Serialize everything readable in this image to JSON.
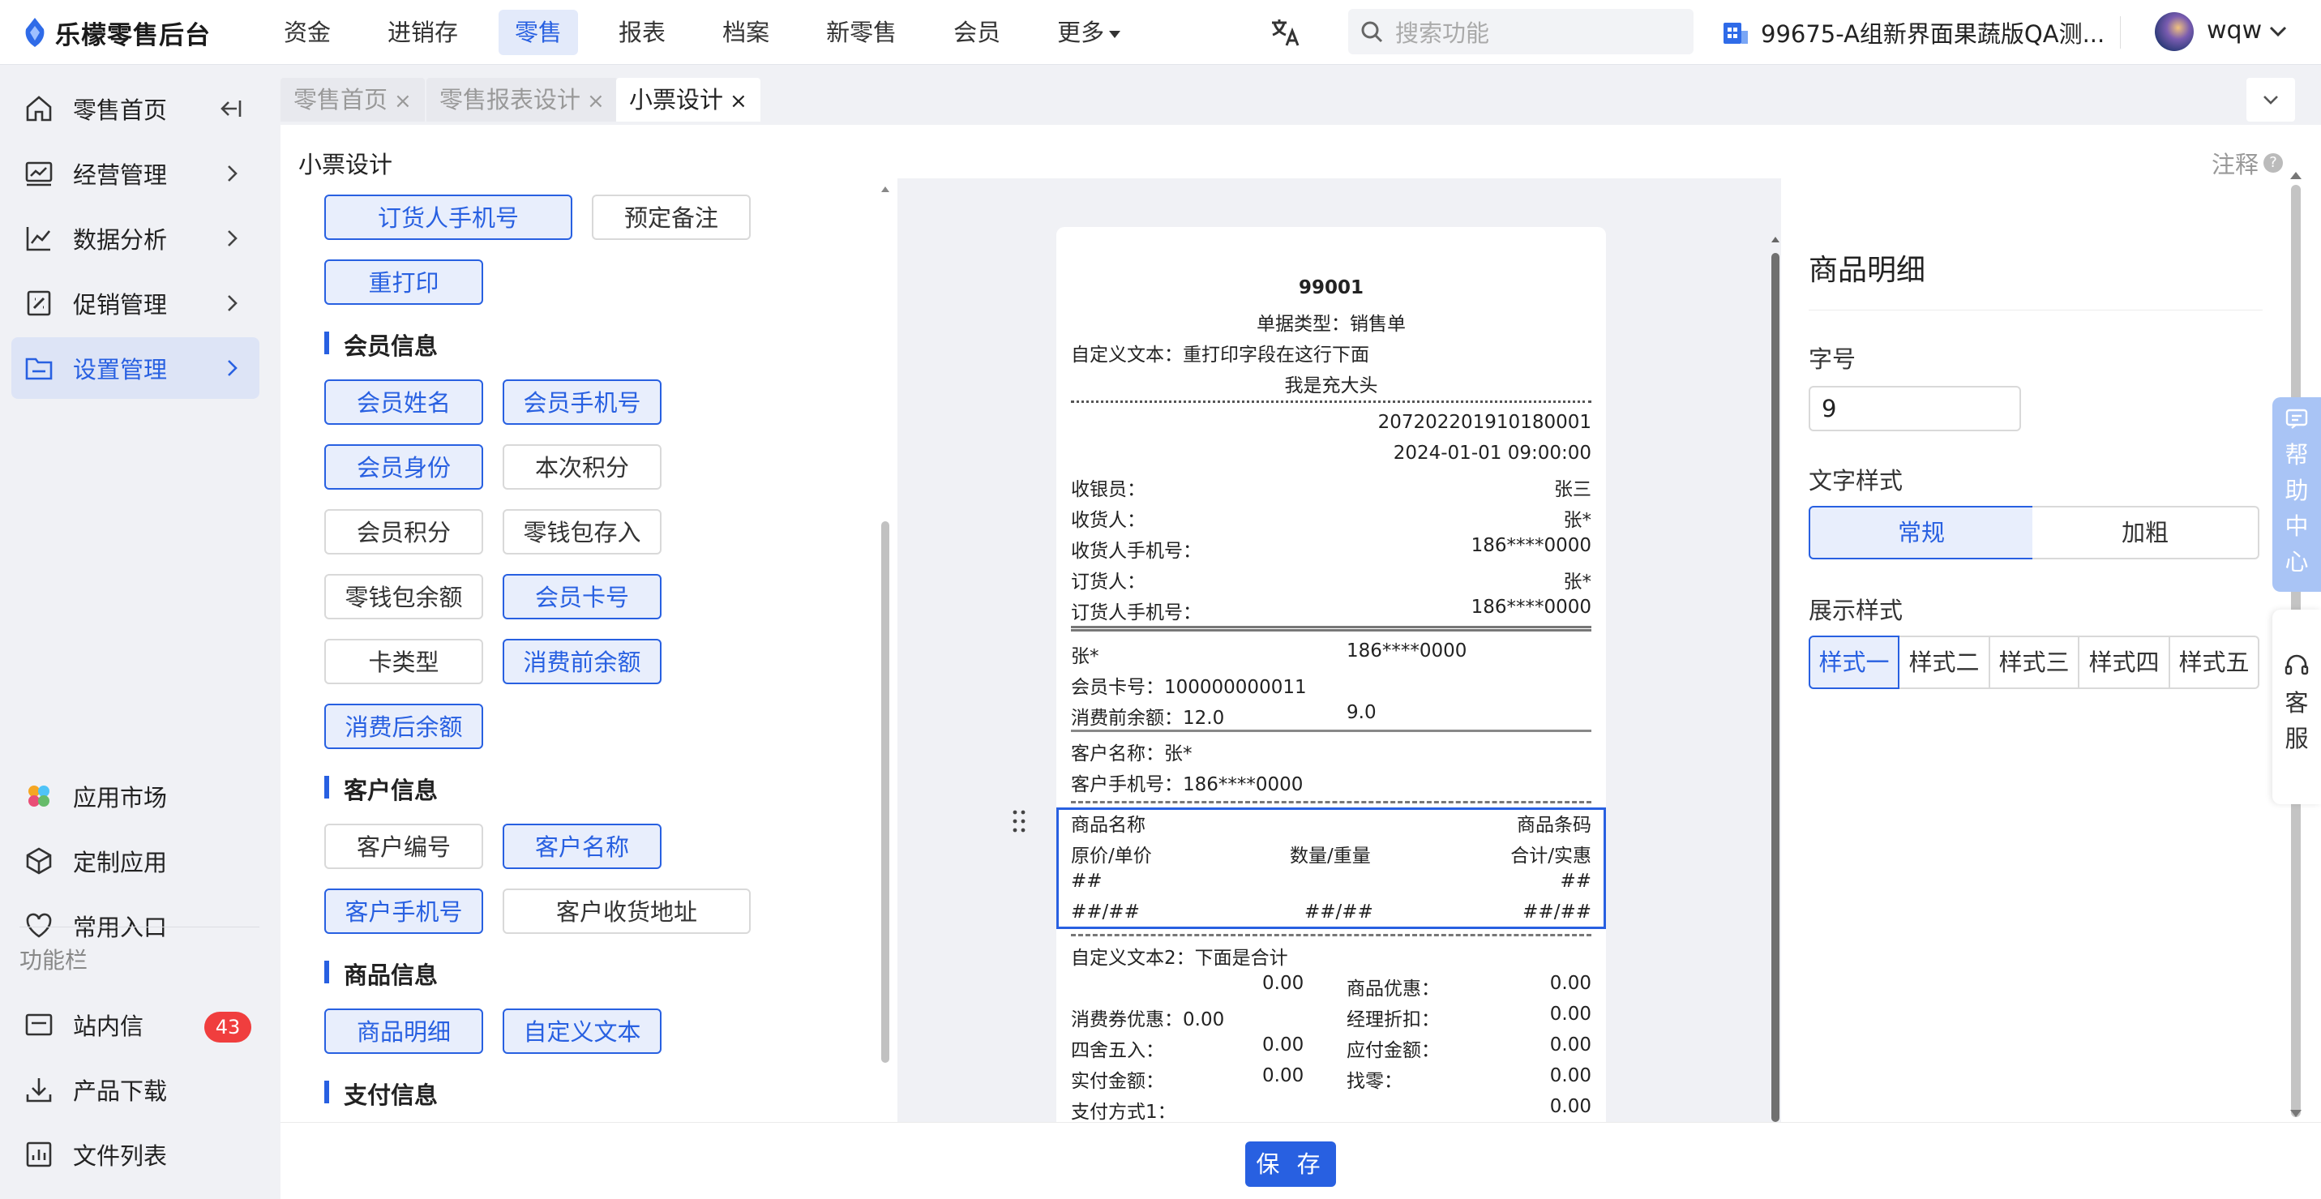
{
  "app": {
    "title": "乐檬零售后台"
  },
  "nav": {
    "items": [
      "资金",
      "进销存",
      "零售",
      "报表",
      "档案",
      "新零售",
      "会员",
      "更多"
    ],
    "active": "零售"
  },
  "search": {
    "placeholder": "搜索功能"
  },
  "store": {
    "name": "99675-A组新界面果蔬版QA测..."
  },
  "user": {
    "name": "wqw"
  },
  "sidebar": {
    "items": [
      {
        "label": "零售首页",
        "icon": "home-icon"
      },
      {
        "label": "经营管理",
        "icon": "chart-board-icon"
      },
      {
        "label": "数据分析",
        "icon": "line-chart-icon"
      },
      {
        "label": "促销管理",
        "icon": "promo-icon"
      },
      {
        "label": "设置管理",
        "icon": "folder-icon"
      }
    ],
    "bottom": [
      {
        "label": "应用市场",
        "icon": "app-market-icon"
      },
      {
        "label": "定制应用",
        "icon": "cube-icon"
      },
      {
        "label": "常用入口",
        "icon": "heart-icon"
      }
    ],
    "section_label": "功能栏",
    "tools": [
      {
        "label": "站内信",
        "icon": "mail-icon",
        "badge": "43"
      },
      {
        "label": "产品下载",
        "icon": "download-icon"
      },
      {
        "label": "文件列表",
        "icon": "file-list-icon"
      }
    ]
  },
  "tabs": [
    {
      "label": "零售首页",
      "close": "×"
    },
    {
      "label": "零售报表设计",
      "close": "×"
    },
    {
      "label": "小票设计",
      "close": "×"
    }
  ],
  "page": {
    "title": "小票设计",
    "notes": "注释",
    "help_mark": "?"
  },
  "fields": {
    "top": [
      "订货人手机号",
      "预定备注",
      "重打印"
    ],
    "member_title": "会员信息",
    "member": [
      "会员姓名",
      "会员手机号",
      "会员身份",
      "本次积分",
      "会员积分",
      "零钱包存入",
      "零钱包余额",
      "会员卡号",
      "卡类型",
      "消费前余额",
      "消费后余额"
    ],
    "customer_title": "客户信息",
    "customer": [
      "客户编号",
      "客户名称",
      "客户手机号",
      "客户收货地址"
    ],
    "goods_title": "商品信息",
    "goods": [
      "商品明细",
      "自定义文本"
    ],
    "pay_title": "支付信息"
  },
  "receipt": {
    "store_no": "99001",
    "doc_type": "单据类型：销售单",
    "custom_text": "自定义文本：重打印字段在这行下面",
    "header_fill": "我是充大头",
    "order_no": "207202201910180001",
    "datetime": "2024-01-01 09:00:00",
    "rows": [
      {
        "k": "收银员：",
        "v": "张三"
      },
      {
        "k": "收货人：",
        "v": "张*"
      },
      {
        "k": "收货人手机号：",
        "v": "186****0000"
      },
      {
        "k": "订货人：",
        "v": "张*"
      },
      {
        "k": "订货人手机号：",
        "v": "186****0000"
      }
    ],
    "member_name": "张*",
    "member_phone": "186****0000",
    "member_card": "会员卡号：100000000011",
    "balance_before": "消费前余额：12.0",
    "balance_after": "9.0",
    "customer_name": "客户名称：张*",
    "customer_phone": "客户手机号：186****0000",
    "goods": {
      "name": "商品名称",
      "barcode": "商品条码",
      "price": "原价/单价",
      "qty": "数量/重量",
      "total": "合计/实惠",
      "hash1": "##",
      "hash2": "##",
      "hash3": "##/##",
      "hash4": "##/##",
      "hash5": "##/##"
    },
    "custom_text2": "自定义文本2：下面是合计",
    "totals": {
      "r1_v1": "0.00",
      "r1_k2": "商品优惠：",
      "r1_v2": "0.00",
      "r2_k1": "消费券优惠：0.00",
      "r2_k2": "经理折扣：",
      "r2_v2": "0.00",
      "r3_k1": "四舍五入：",
      "r3_v1": "0.00",
      "r3_k2": "应付金额：",
      "r3_v2": "0.00",
      "r4_k1": "实付金额：",
      "r4_v1": "0.00",
      "r4_k2": "找零：",
      "r4_v2": "0.00",
      "r5_k1": "支付方式1：",
      "r5_v2": "0.00"
    }
  },
  "panel": {
    "title": "商品明细",
    "font_size_label": "字号",
    "font_size_value": "9",
    "text_style_label": "文字样式",
    "text_styles": [
      "常规",
      "加粗"
    ],
    "display_style_label": "展示样式",
    "display_styles": [
      "样式一",
      "样式二",
      "样式三",
      "样式四",
      "样式五"
    ]
  },
  "help": {
    "chars": [
      "帮",
      "助",
      "中",
      "心"
    ]
  },
  "service": {
    "chars": [
      "客",
      "服"
    ]
  },
  "footer": {
    "save": "保 存"
  },
  "colors": {
    "accent": "#2860e1",
    "accent_bg": "#e8eefc",
    "badge": "#f03e3e"
  }
}
